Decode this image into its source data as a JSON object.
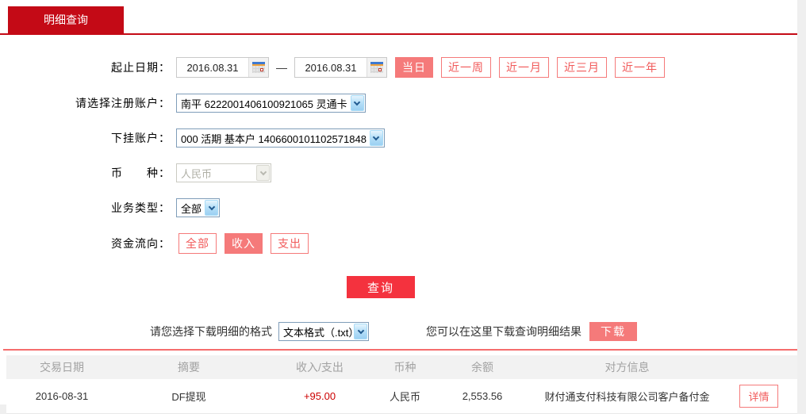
{
  "tab": {
    "label": "明细查询"
  },
  "form": {
    "date_range": {
      "label": "起止日期：",
      "start": "2016.08.31",
      "end": "2016.08.31",
      "separator": "—",
      "quick_buttons": [
        {
          "label": "当日",
          "active": true
        },
        {
          "label": "近一周",
          "active": false
        },
        {
          "label": "近一月",
          "active": false
        },
        {
          "label": "近三月",
          "active": false
        },
        {
          "label": "近一年",
          "active": false
        }
      ]
    },
    "registered_account": {
      "label": "请选择注册账户：",
      "value": "南平 6222001406100921065 灵通卡"
    },
    "sub_account": {
      "label": "下挂账户：",
      "value": "000 活期 基本户 1406600101102571848"
    },
    "currency": {
      "label": "币　　种：",
      "value": "人民币",
      "disabled": true
    },
    "business_type": {
      "label": "业务类型：",
      "value": "全部"
    },
    "fund_flow": {
      "label": "资金流向：",
      "options": [
        {
          "label": "全部",
          "active": false
        },
        {
          "label": "收入",
          "active": true
        },
        {
          "label": "支出",
          "active": false
        }
      ]
    },
    "query_button": "查询"
  },
  "download": {
    "format_label": "请您选择下载明细的格式",
    "format_value": "文本格式（.txt）",
    "hint": "您可以在这里下载查询明细结果",
    "button": "下载"
  },
  "table": {
    "headers": [
      "交易日期",
      "摘要",
      "收入/支出",
      "币种",
      "余额",
      "对方信息"
    ],
    "rows": [
      {
        "date": "2016-08-31",
        "summary": "DF提现",
        "amount": "+95.00",
        "currency": "人民币",
        "balance": "2,553.56",
        "counterparty": "财付通支付科技有限公司客户备付金",
        "detail_button": "详情"
      }
    ]
  },
  "colors": {
    "accent_red": "#c40a16",
    "query_button_red": "#f4323e",
    "salmon": "#f57a7a",
    "amount_red": "#cc0000"
  }
}
